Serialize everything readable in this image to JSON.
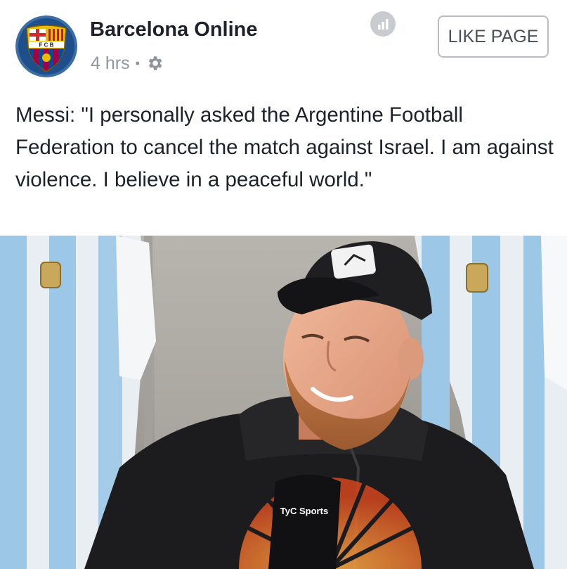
{
  "post": {
    "page_name": "Barcelona Online",
    "timestamp": "4 hrs",
    "separator": "•",
    "privacy_icon": "gear-icon",
    "stats_icon": "insights-icon",
    "like_button": "LIKE PAGE",
    "avatar_icon": "fc-barcelona-crest",
    "text": "Messi: \"I personally asked the Argentine Football Federation to cancel the match against Israel. I am against violence. I believe in a peaceful world.\""
  },
  "photo": {
    "mic_brand": "TyC Sports",
    "subject": "photo-of-messi"
  },
  "colors": {
    "text": "#1d2129",
    "meta": "#90949c",
    "barca_blue": "#004d98",
    "barca_red": "#a50044",
    "barca_gold": "#edbb00"
  }
}
